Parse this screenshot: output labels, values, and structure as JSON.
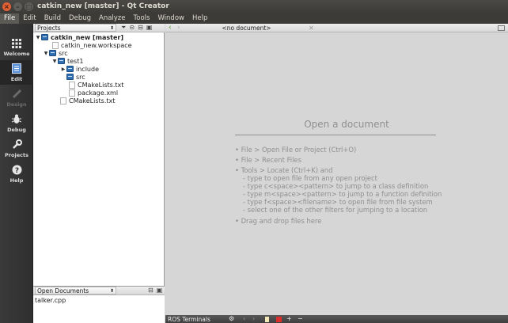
{
  "window": {
    "title": "catkin_new [master] - Qt Creator"
  },
  "menu": [
    "File",
    "Edit",
    "Build",
    "Debug",
    "Analyze",
    "Tools",
    "Window",
    "Help"
  ],
  "modes": [
    {
      "label": "Welcome",
      "icon": "grid-icon"
    },
    {
      "label": "Edit",
      "icon": "document-icon"
    },
    {
      "label": "Design",
      "icon": "pencil-icon"
    },
    {
      "label": "Debug",
      "icon": "bug-icon"
    },
    {
      "label": "Projects",
      "icon": "wrench-icon"
    },
    {
      "label": "Help",
      "icon": "question-icon"
    }
  ],
  "project_pane": {
    "selector": "Projects",
    "tree": [
      {
        "label": "catkin_new [master]",
        "bold": true,
        "type": "project",
        "expanded": true
      },
      {
        "label": "catkin_new.workspace",
        "type": "file"
      },
      {
        "label": "src",
        "type": "folder",
        "expanded": true
      },
      {
        "label": "test1",
        "type": "folder",
        "expanded": true
      },
      {
        "label": "include",
        "type": "folder",
        "expanded": false
      },
      {
        "label": "src",
        "type": "folder"
      },
      {
        "label": "CMakeLists.txt",
        "type": "file"
      },
      {
        "label": "package.xml",
        "type": "file"
      },
      {
        "label": "CMakeLists.txt",
        "type": "file"
      }
    ]
  },
  "open_documents": {
    "title": "Open Documents",
    "items": [
      "talker.cpp"
    ]
  },
  "editor": {
    "doc_selector": "<no document>",
    "placeholder": {
      "title": "Open a document",
      "items": [
        "• File > Open File or Project (Ctrl+O)",
        "• File > Recent Files",
        "• Tools > Locate (Ctrl+K) and"
      ],
      "subitems": [
        "- type to open file from any open project",
        "- type c<space><pattern> to jump to a class definition",
        "- type m<space><pattern> to jump to a function definition",
        "- type f<space><filename> to open file from file system",
        "- select one of the other filters for jumping to a location"
      ],
      "last": "• Drag and drop files here"
    }
  },
  "output": {
    "label": "ROS Terminals"
  },
  "colors": {
    "titlebar": "#3c3b37",
    "modebar": "#303030",
    "accent": "#2f6fb2"
  }
}
